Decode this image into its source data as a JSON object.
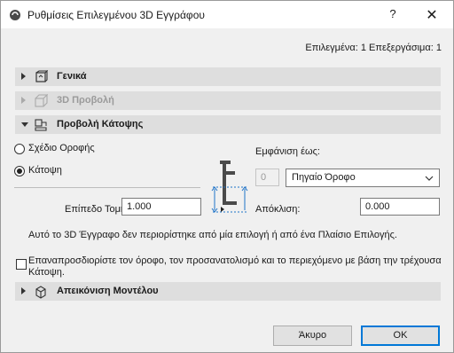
{
  "window": {
    "title": "Ρυθμίσεις Επιλεγμένου 3D Εγγράφου",
    "help_glyph": "?",
    "close_glyph": "✕"
  },
  "selection_info": "Επιλεγμένα: 1 Επεξεργάσιμα: 1",
  "sections": {
    "general": "Γενικά",
    "view3d": "3D Προβολή",
    "floorplan": "Προβολή Κάτοψης",
    "model": "Απεικόνιση Μοντέλου"
  },
  "radios": {
    "ceiling_plan": "Σχέδιο Οροφής",
    "floor_plan": "Κάτοψη",
    "selected": "floor_plan"
  },
  "show_to": {
    "label": "Εμφάνιση έως:",
    "number_value": "0",
    "dropdown_value": "Πηγαίο Όροφο"
  },
  "cut_plane": {
    "label": "Επίπεδο Τομής:",
    "value": "1.000"
  },
  "offset": {
    "label": "Απόκλιση:",
    "value": "0.000"
  },
  "info_text": "Αυτό το 3D Έγγραφο δεν περιορίστηκε από μία επιλογή ή από ένα Πλαίσιο Επιλογής.",
  "restore_checkbox": {
    "label": "Επαναπροσδιορίστε τον όροφο, τον προσανατολισμό και το περιεχόμενο με βάση την τρέχουσα Κάτοψη.",
    "checked": false
  },
  "buttons": {
    "cancel": "Άκυρο",
    "ok": "ΟΚ"
  },
  "colors": {
    "accent": "#0078d7",
    "section_bg": "#dedede",
    "dialog_bg": "#f0f0f0",
    "diagram_blue": "#1e73c8"
  }
}
